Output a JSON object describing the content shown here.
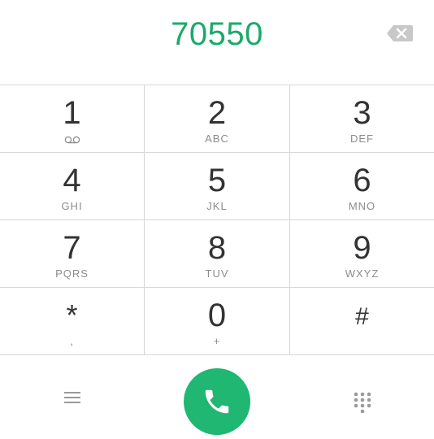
{
  "display": {
    "number": "70550"
  },
  "keypad": {
    "keys": [
      {
        "digit": "1",
        "letters": "",
        "sub_icon": "voicemail-icon"
      },
      {
        "digit": "2",
        "letters": "ABC"
      },
      {
        "digit": "3",
        "letters": "DEF"
      },
      {
        "digit": "4",
        "letters": "GHI"
      },
      {
        "digit": "5",
        "letters": "JKL"
      },
      {
        "digit": "6",
        "letters": "MNO"
      },
      {
        "digit": "7",
        "letters": "PQRS"
      },
      {
        "digit": "8",
        "letters": "TUV"
      },
      {
        "digit": "9",
        "letters": "WXYZ"
      },
      {
        "digit": "*",
        "letters": ","
      },
      {
        "digit": "0",
        "letters": "+"
      },
      {
        "digit": "#",
        "letters": ""
      }
    ]
  },
  "bottom_bar": {
    "left_icon": "menu-icon",
    "center_icon": "phone-icon",
    "right_icon": "dialpad-icon"
  },
  "colors": {
    "accent": "#1aaa6b",
    "call_button": "#1fb771",
    "digit_text": "#333333",
    "letters_text": "#8c8c8c",
    "divider": "#d6d6d6",
    "backspace_icon": "#c8c8c8",
    "bottom_icons": "#9a9a9a"
  }
}
